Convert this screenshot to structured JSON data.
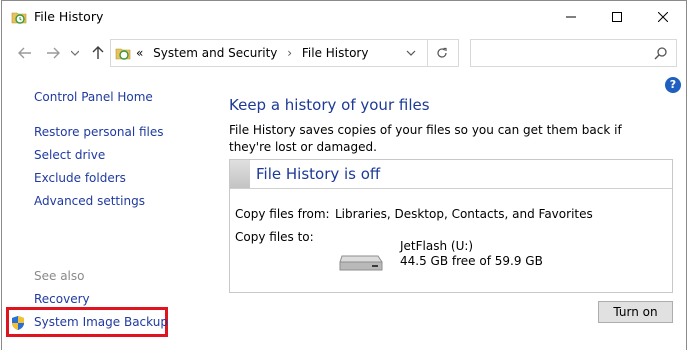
{
  "window": {
    "title": "File History"
  },
  "navbar": {
    "back_icon": "back-arrow-icon",
    "forward_icon": "forward-arrow-icon",
    "up_icon": "up-arrow-icon",
    "address": {
      "overflow": "«",
      "crumbs": [
        "System and Security",
        "File History"
      ],
      "separator": "›"
    },
    "search": {
      "placeholder": ""
    }
  },
  "left_pane": {
    "home_link": "Control Panel Home",
    "tasks": [
      "Restore personal files",
      "Select drive",
      "Exclude folders",
      "Advanced settings"
    ],
    "see_also_label": "See also",
    "see_also": [
      "Recovery",
      "System Image Backup"
    ]
  },
  "main": {
    "heading": "Keep a history of your files",
    "description": "File History saves copies of your files so you can get them back if they're lost or damaged.",
    "status": {
      "title": "File History is off",
      "copy_from_label": "Copy files from:",
      "copy_from_value": "Libraries, Desktop, Contacts, and Favorites",
      "copy_to_label": "Copy files to:",
      "drive_name": "JetFlash (U:)",
      "drive_space": "44.5 GB free of 59.9 GB"
    },
    "turn_on_button": "Turn on"
  },
  "colors": {
    "link": "#1f3aa0",
    "heading": "#1e3a96",
    "highlight_box": "#e0141e"
  }
}
